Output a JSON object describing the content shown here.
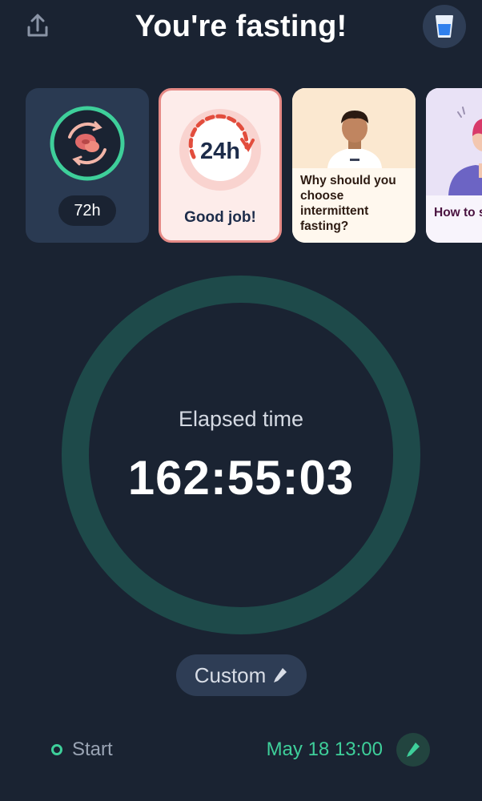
{
  "header": {
    "title": "You're fasting!",
    "share_icon": "share-icon",
    "water_icon": "water-glass-icon"
  },
  "cards": [
    {
      "label": "72h",
      "icon": "cell-renewal-icon"
    },
    {
      "badge": "24h",
      "label": "Good job!"
    },
    {
      "label": "Why should you choose intermittent fasting?"
    },
    {
      "label": "How to s… motivate…"
    }
  ],
  "timer": {
    "label": "Elapsed time",
    "value": "162:55:03",
    "progress": 0
  },
  "plan": {
    "label": "Custom",
    "icon": "pencil-icon"
  },
  "start": {
    "label": "Start",
    "time": "May 18 13:00",
    "icon": "pencil-icon"
  },
  "colors": {
    "background": "#1a2332",
    "accent": "#3ecf9a",
    "ring": "#1e4a4a",
    "surface": "#2e3d55"
  }
}
